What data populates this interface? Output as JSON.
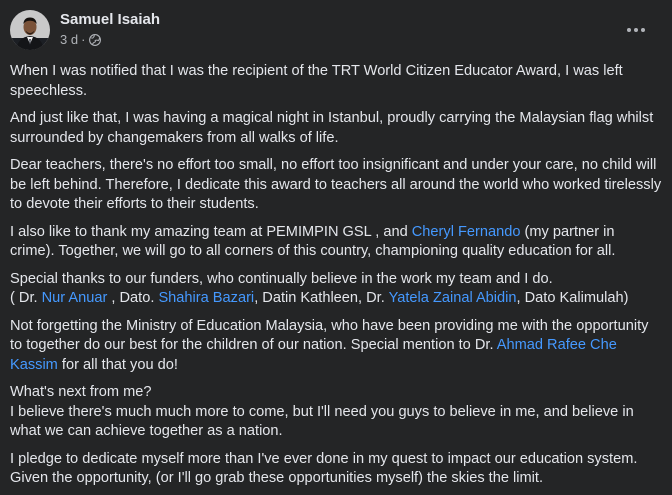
{
  "post": {
    "author": "Samuel Isaiah",
    "time": "3 d",
    "dot": "·",
    "privacy_icon": "globe-icon",
    "more_icon": "more-horizontal-icon",
    "paragraphs": [
      {
        "lines": [
          [
            {
              "text": "When I was notified that I was the recipient of the TRT World Citizen Educator Award, I was left speechless."
            }
          ]
        ]
      },
      {
        "lines": [
          [
            {
              "text": "And just like that, I was having a magical night in Istanbul, proudly carrying the Malaysian flag whilst surrounded by changemakers from all walks of life."
            }
          ]
        ]
      },
      {
        "lines": [
          [
            {
              "text": "Dear teachers, there's no effort too small, no effort too insignificant and under your care, no child will be left behind. Therefore, I dedicate this award to teachers all around the world who worked tirelessly to devote their efforts to their students."
            }
          ]
        ]
      },
      {
        "lines": [
          [
            {
              "text": "I also like to thank my amazing team at PEMIMPIN GSL , and "
            },
            {
              "text": "Cheryl Fernando",
              "mention": true
            },
            {
              "text": " (my partner in crime). Together, we will go to all corners of this country, championing quality education for all."
            }
          ]
        ]
      },
      {
        "lines": [
          [
            {
              "text": "Special thanks to our funders, who continually believe in the work my team and I do."
            }
          ],
          [
            {
              "text": "( Dr. "
            },
            {
              "text": "Nur Anuar",
              "mention": true
            },
            {
              "text": " , Dato. "
            },
            {
              "text": "Shahira Bazari",
              "mention": true
            },
            {
              "text": ", Datin Kathleen, Dr. "
            },
            {
              "text": "Yatela Zainal Abidin",
              "mention": true
            },
            {
              "text": ", Dato Kalimulah)"
            }
          ]
        ]
      },
      {
        "lines": [
          [
            {
              "text": "Not forgetting the Ministry of Education Malaysia, who have been providing me with the opportunity to together do our best for the children of our nation. Special mention to Dr. "
            },
            {
              "text": "Ahmad Rafee Che Kassim",
              "mention": true
            },
            {
              "text": "  for all that you do!"
            }
          ]
        ]
      },
      {
        "lines": [
          [
            {
              "text": "What's next from me?"
            }
          ],
          [
            {
              "text": "I believe there's much much more to come, but I'll need you guys to believe in me, and believe in what we can achieve together as a nation."
            }
          ]
        ]
      },
      {
        "lines": [
          [
            {
              "text": "I pledge to dedicate myself more than I've ever done in my quest to impact our education system. Given the opportunity, (or I'll go grab these opportunities myself) the skies the limit."
            }
          ]
        ]
      }
    ]
  },
  "colors": {
    "background": "#242526",
    "text": "#e4e6eb",
    "secondary_text": "#b0b3b8",
    "mention": "#4599ff"
  }
}
